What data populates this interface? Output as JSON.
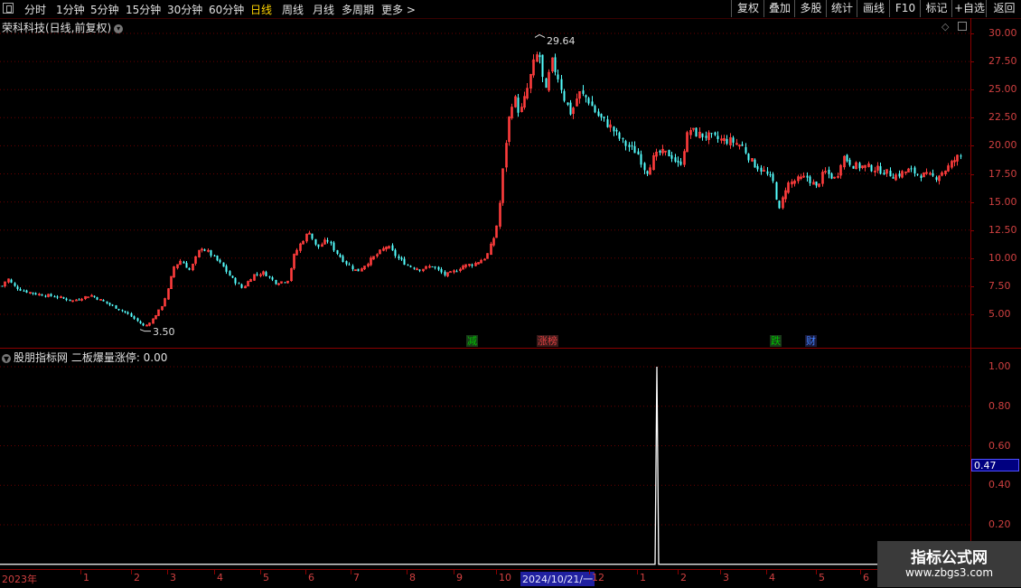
{
  "toolbar": {
    "periods": [
      {
        "label": "分时",
        "active": false
      },
      {
        "label": "1分钟",
        "active": false
      },
      {
        "label": "5分钟",
        "active": false
      },
      {
        "label": "15分钟",
        "active": false
      },
      {
        "label": "30分钟",
        "active": false
      },
      {
        "label": "60分钟",
        "active": false
      },
      {
        "label": "日线",
        "active": true
      },
      {
        "label": "周线",
        "active": false
      },
      {
        "label": "月线",
        "active": false
      },
      {
        "label": "多周期",
        "active": false
      },
      {
        "label": "更多 >",
        "active": false
      }
    ],
    "right_buttons": [
      "复权",
      "叠加",
      "多股",
      "统计",
      "画线",
      "F10",
      "标记",
      "+自选",
      "返回"
    ]
  },
  "main_chart": {
    "title": "荣科科技(日线,前复权)",
    "high_label": "29.64",
    "low_label": "3.50",
    "y_ticks": [
      "30.00",
      "27.50",
      "25.00",
      "22.50",
      "20.00",
      "17.50",
      "15.00",
      "12.50",
      "10.00",
      "7.50",
      "5.00"
    ],
    "event_tags": [
      {
        "text": "减",
        "color": "#00c000"
      },
      {
        "text": "涨榜",
        "color": "#e04040"
      },
      {
        "text": "跌",
        "color": "#00c000"
      },
      {
        "text": "财",
        "color": "#4080ff"
      }
    ]
  },
  "indicator": {
    "title": "股朋指标网 二板爆量涨停: 0.00",
    "y_ticks": [
      "1.00",
      "0.80",
      "0.60",
      "0.40",
      "0.20"
    ],
    "current_value": "0.47"
  },
  "timebar": {
    "labels": [
      "2023年",
      "1",
      "2",
      "3",
      "4",
      "5",
      "6",
      "7",
      "8",
      "9",
      "10",
      "2024/10/21/一",
      "12",
      "1",
      "2",
      "3",
      "4",
      "5",
      "6"
    ]
  },
  "watermark": {
    "line1": "指标公式网",
    "line2": "www.zbgs3.com"
  },
  "chart_data": {
    "type": "candlestick",
    "y_range": [
      3.0,
      31.0
    ],
    "close_path": [
      [
        0,
        7.3
      ],
      [
        8,
        8.2
      ],
      [
        15,
        7.5
      ],
      [
        25,
        7.1
      ],
      [
        40,
        6.8
      ],
      [
        60,
        6.6
      ],
      [
        80,
        6.2
      ],
      [
        100,
        6.7
      ],
      [
        120,
        5.9
      ],
      [
        140,
        5.1
      ],
      [
        155,
        4.2
      ],
      [
        160,
        3.9
      ],
      [
        168,
        4.5
      ],
      [
        178,
        5.6
      ],
      [
        185,
        7.0
      ],
      [
        192,
        9.2
      ],
      [
        200,
        9.8
      ],
      [
        210,
        8.9
      ],
      [
        222,
        11.0
      ],
      [
        232,
        10.4
      ],
      [
        245,
        9.4
      ],
      [
        255,
        8.3
      ],
      [
        268,
        7.3
      ],
      [
        280,
        8.5
      ],
      [
        292,
        8.7
      ],
      [
        305,
        7.8
      ],
      [
        318,
        8.0
      ],
      [
        325,
        10.2
      ],
      [
        333,
        11.4
      ],
      [
        342,
        12.4
      ],
      [
        350,
        10.9
      ],
      [
        362,
        11.6
      ],
      [
        372,
        10.5
      ],
      [
        382,
        9.6
      ],
      [
        395,
        8.8
      ],
      [
        405,
        9.5
      ],
      [
        418,
        10.4
      ],
      [
        428,
        11.1
      ],
      [
        440,
        10.0
      ],
      [
        452,
        9.3
      ],
      [
        465,
        9.0
      ],
      [
        478,
        9.3
      ],
      [
        492,
        8.5
      ],
      [
        500,
        8.7
      ],
      [
        512,
        9.3
      ],
      [
        525,
        9.5
      ],
      [
        538,
        10.1
      ],
      [
        548,
        12.2
      ],
      [
        552,
        14.2
      ],
      [
        558,
        19.3
      ],
      [
        562,
        22.0
      ],
      [
        568,
        24.5
      ],
      [
        575,
        22.8
      ],
      [
        582,
        24.6
      ],
      [
        590,
        27.2
      ],
      [
        596,
        28.5
      ],
      [
        603,
        24.4
      ],
      [
        610,
        27.5
      ],
      [
        618,
        26.0
      ],
      [
        625,
        24.0
      ],
      [
        632,
        22.8
      ],
      [
        640,
        24.7
      ],
      [
        650,
        24.2
      ],
      [
        660,
        22.8
      ],
      [
        675,
        21.7
      ],
      [
        690,
        20.2
      ],
      [
        705,
        19.4
      ],
      [
        715,
        17.6
      ],
      [
        722,
        18.8
      ],
      [
        730,
        19.4
      ],
      [
        742,
        19.2
      ],
      [
        752,
        18.1
      ],
      [
        762,
        21.5
      ],
      [
        772,
        21.0
      ],
      [
        785,
        20.8
      ],
      [
        798,
        20.5
      ],
      [
        810,
        20.4
      ],
      [
        822,
        19.9
      ],
      [
        832,
        18.5
      ],
      [
        845,
        17.7
      ],
      [
        855,
        16.9
      ],
      [
        862,
        14.2
      ],
      [
        870,
        16.5
      ],
      [
        880,
        16.9
      ],
      [
        893,
        17.2
      ],
      [
        903,
        16.3
      ],
      [
        912,
        17.7
      ],
      [
        925,
        17.0
      ],
      [
        932,
        19.1
      ],
      [
        945,
        18.2
      ],
      [
        960,
        18.1
      ],
      [
        975,
        17.8
      ],
      [
        990,
        17.3
      ],
      [
        1005,
        17.8
      ],
      [
        1020,
        17.4
      ],
      [
        1035,
        17.2
      ],
      [
        1048,
        18.0
      ],
      [
        1058,
        18.9
      ],
      [
        1066,
        19.2
      ]
    ],
    "indicator_series": [
      {
        "name": "二板爆量涨停",
        "spike_at_x": 727,
        "value": 1.0
      }
    ]
  }
}
